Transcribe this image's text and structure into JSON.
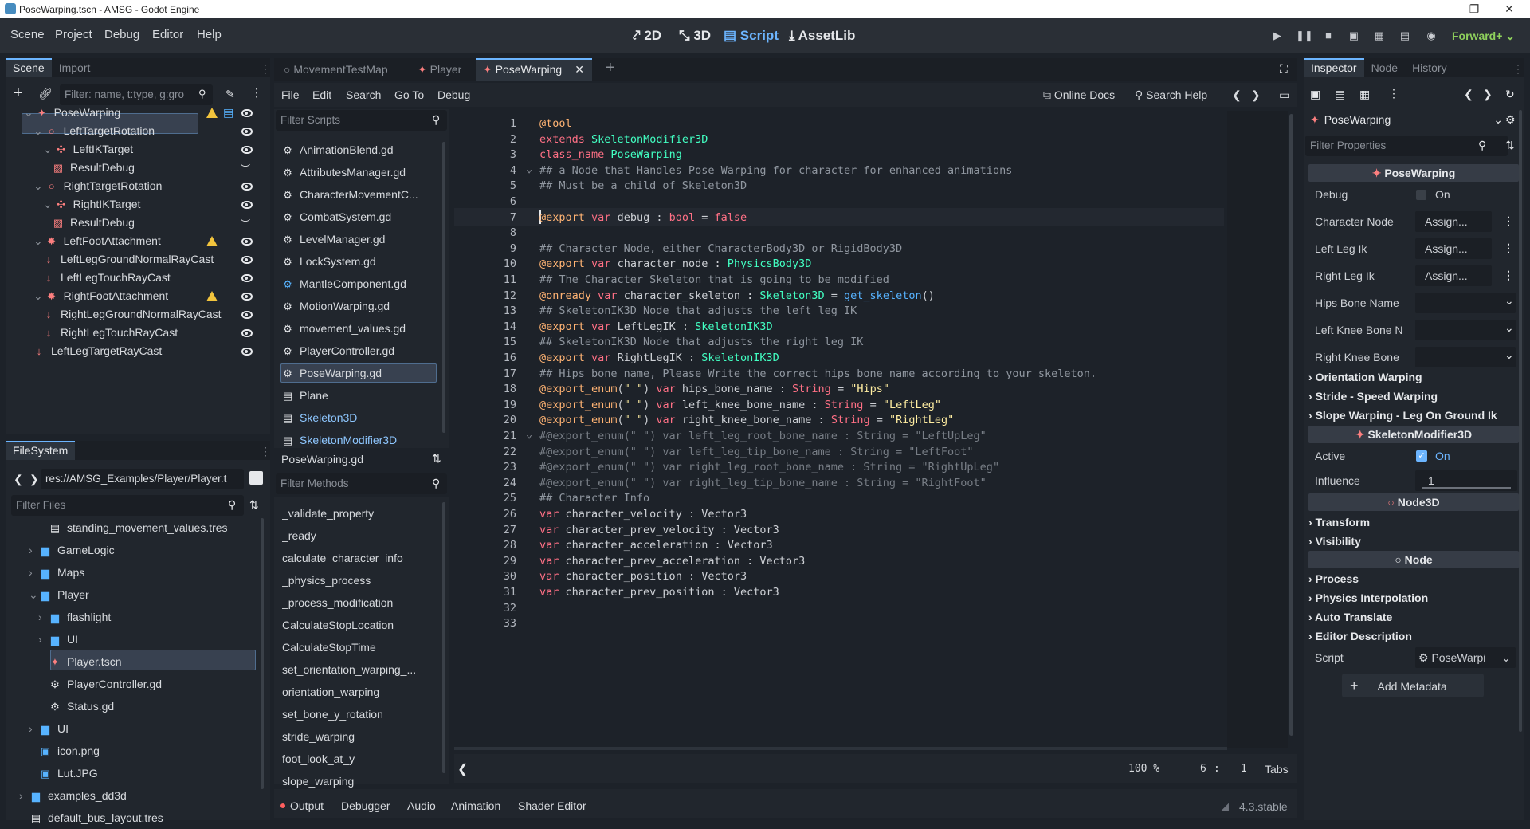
{
  "window": {
    "title": "PoseWarping.tscn - AMSG - Godot Engine"
  },
  "menus": [
    "Scene",
    "Project",
    "Debug",
    "Editor",
    "Help"
  ],
  "workspaces": [
    {
      "label": "2D",
      "icon": "2d-icon"
    },
    {
      "label": "3D",
      "icon": "3d-icon"
    },
    {
      "label": "Script",
      "icon": "script-icon"
    },
    {
      "label": "AssetLib",
      "icon": "assetlib-icon"
    }
  ],
  "renderer": "Forward+",
  "scene_dock": {
    "tabs": [
      "Scene",
      "Import"
    ],
    "filter_placeholder": "Filter: name, t:type, g:gro",
    "nodes": [
      {
        "label": "PoseWarping",
        "depth": 0,
        "icon": "pose-warping-icon",
        "warn": true,
        "script": true
      },
      {
        "label": "LeftTargetRotation",
        "depth": 1,
        "icon": "node3d-icon"
      },
      {
        "label": "LeftIKTarget",
        "depth": 2,
        "icon": "marker3d-icon"
      },
      {
        "label": "ResultDebug",
        "depth": 3,
        "icon": "debug-icon",
        "hidden_eye": true
      },
      {
        "label": "RightTargetRotation",
        "depth": 1,
        "icon": "node3d-icon"
      },
      {
        "label": "RightIKTarget",
        "depth": 2,
        "icon": "marker3d-icon"
      },
      {
        "label": "ResultDebug",
        "depth": 3,
        "icon": "debug-icon",
        "hidden_eye": true
      },
      {
        "label": "LeftFootAttachment",
        "depth": 1,
        "icon": "attachment-icon",
        "warn": true
      },
      {
        "label": "LeftLegGroundNormalRayCast",
        "depth": 2,
        "icon": "raycast-icon"
      },
      {
        "label": "LeftLegTouchRayCast",
        "depth": 2,
        "icon": "raycast-icon"
      },
      {
        "label": "RightFootAttachment",
        "depth": 1,
        "icon": "attachment-icon",
        "warn": true
      },
      {
        "label": "RightLegGroundNormalRayCast",
        "depth": 2,
        "icon": "raycast-icon"
      },
      {
        "label": "RightLegTouchRayCast",
        "depth": 2,
        "icon": "raycast-icon"
      },
      {
        "label": "LeftLegTargetRayCast",
        "depth": 1,
        "icon": "raycast-icon"
      }
    ]
  },
  "filesystem": {
    "tab": "FileSystem",
    "path": "res://AMSG_Examples/Player/Player.t",
    "filter_placeholder": "Filter Files",
    "items": [
      {
        "label": "standing_movement_values.tres",
        "depth": 3,
        "icon": "resource-icon"
      },
      {
        "label": "GameLogic",
        "depth": 2,
        "icon": "folder-icon",
        "arrow": "›"
      },
      {
        "label": "Maps",
        "depth": 2,
        "icon": "folder-icon",
        "arrow": "›"
      },
      {
        "label": "Player",
        "depth": 2,
        "icon": "folder-icon",
        "arrow": "⌄"
      },
      {
        "label": "flashlight",
        "depth": 3,
        "icon": "folder-icon",
        "arrow": "›"
      },
      {
        "label": "UI",
        "depth": 3,
        "icon": "folder-icon",
        "arrow": "›"
      },
      {
        "label": "Player.tscn",
        "depth": 3,
        "icon": "scene-icon"
      },
      {
        "label": "PlayerController.gd",
        "depth": 3,
        "icon": "gear-icon"
      },
      {
        "label": "Status.gd",
        "depth": 3,
        "icon": "gear-icon"
      },
      {
        "label": "UI",
        "depth": 2,
        "icon": "folder-icon",
        "arrow": "›"
      },
      {
        "label": "icon.png",
        "depth": 2,
        "icon": "image-icon"
      },
      {
        "label": "Lut.JPG",
        "depth": 2,
        "icon": "image-icon"
      },
      {
        "label": "examples_dd3d",
        "depth": 1,
        "icon": "folder-icon",
        "arrow": "›"
      },
      {
        "label": "default_bus_layout.tres",
        "depth": 1,
        "icon": "resource-icon"
      }
    ]
  },
  "editor_tabs": [
    "MovementTestMap",
    "Player",
    "PoseWarping"
  ],
  "script_menu": {
    "items": [
      "File",
      "Edit",
      "Search",
      "Go To",
      "Debug"
    ],
    "online_docs": "Online Docs",
    "search_help": "Search Help"
  },
  "scripts": {
    "filter_placeholder": "Filter Scripts",
    "items": [
      {
        "label": "AnimationBlend.gd",
        "icon": "gear-icon"
      },
      {
        "label": "AttributesManager.gd",
        "icon": "gear-icon"
      },
      {
        "label": "CharacterMovementC...",
        "icon": "gear-icon"
      },
      {
        "label": "CombatSystem.gd",
        "icon": "gear-icon"
      },
      {
        "label": "LevelManager.gd",
        "icon": "gear-icon"
      },
      {
        "label": "LockSystem.gd",
        "icon": "gear-icon"
      },
      {
        "label": "MantleComponent.gd",
        "icon": "gear-icon"
      },
      {
        "label": "MotionWarping.gd",
        "icon": "gear-icon"
      },
      {
        "label": "movement_values.gd",
        "icon": "gear-icon"
      },
      {
        "label": "PlayerController.gd",
        "icon": "gear-icon"
      },
      {
        "label": "PoseWarping.gd",
        "icon": "gear-icon"
      },
      {
        "label": "Plane",
        "icon": "doc-icon"
      },
      {
        "label": "Skeleton3D",
        "icon": "doc-icon"
      },
      {
        "label": "SkeletonModifier3D",
        "icon": "doc-icon"
      }
    ],
    "current": "PoseWarping.gd"
  },
  "methods": {
    "filter_placeholder": "Filter Methods",
    "items": [
      "_validate_property",
      "_ready",
      "calculate_character_info",
      "_physics_process",
      "_process_modification",
      "CalculateStopLocation",
      "CalculateStopTime",
      "set_orientation_warping_...",
      "orientation_warping",
      "set_bone_y_rotation",
      "stride_warping",
      "foot_look_at_y",
      "slope_warping"
    ]
  },
  "code": {
    "lines": [
      {
        "n": "1",
        "t": "@tool"
      },
      {
        "n": "2",
        "t": "extends SkeletonModifier3D"
      },
      {
        "n": "3",
        "t": "class_name PoseWarping"
      },
      {
        "n": "4",
        "t": "## a Node that Handles Pose Warping for character for enhanced animations"
      },
      {
        "n": "5",
        "t": "## Must be a child of Skeleton3D"
      },
      {
        "n": "6",
        "t": ""
      },
      {
        "n": "7",
        "t": "@export var debug : bool = false"
      },
      {
        "n": "8",
        "t": ""
      },
      {
        "n": "9",
        "t": "## Character Node, either CharacterBody3D or RigidBody3D"
      },
      {
        "n": "10",
        "t": "@export var character_node : PhysicsBody3D"
      },
      {
        "n": "11",
        "t": "## The Character Skeleton that is going to be modified"
      },
      {
        "n": "12",
        "t": "@onready var character_skeleton : Skeleton3D = get_skeleton()"
      },
      {
        "n": "13",
        "t": "## SkeletonIK3D Node that adjusts the left leg IK"
      },
      {
        "n": "14",
        "t": "@export var LeftLegIK : SkeletonIK3D"
      },
      {
        "n": "15",
        "t": "## SkeletonIK3D Node that adjusts the right leg IK"
      },
      {
        "n": "16",
        "t": "@export var RightLegIK : SkeletonIK3D"
      },
      {
        "n": "17",
        "t": "## Hips bone name, Please Write the correct hips bone name according to your skeleton."
      },
      {
        "n": "18",
        "t": "@export_enum(\" \") var hips_bone_name : String = \"Hips\""
      },
      {
        "n": "19",
        "t": "@export_enum(\" \") var left_knee_bone_name : String = \"LeftLeg\""
      },
      {
        "n": "20",
        "t": "@export_enum(\" \") var right_knee_bone_name : String = \"RightLeg\""
      },
      {
        "n": "21",
        "t": "#@export_enum(\" \") var left_leg_root_bone_name : String = \"LeftUpLeg\""
      },
      {
        "n": "22",
        "t": "#@export_enum(\" \") var left_leg_tip_bone_name : String = \"LeftFoot\""
      },
      {
        "n": "23",
        "t": "#@export_enum(\" \") var right_leg_root_bone_name : String = \"RightUpLeg\""
      },
      {
        "n": "24",
        "t": "#@export_enum(\" \") var right_leg_tip_bone_name : String = \"RightFoot\""
      },
      {
        "n": "25",
        "t": "## Character Info"
      },
      {
        "n": "26",
        "t": "var character_velocity : Vector3"
      },
      {
        "n": "27",
        "t": "var character_prev_velocity : Vector3"
      },
      {
        "n": "28",
        "t": "var character_acceleration : Vector3"
      },
      {
        "n": "29",
        "t": "var character_prev_acceleration : Vector3"
      },
      {
        "n": "30",
        "t": "var character_position : Vector3"
      },
      {
        "n": "31",
        "t": "var character_prev_position : Vector3"
      },
      {
        "n": "32",
        "t": ""
      },
      {
        "n": "33",
        "t": ""
      }
    ],
    "zoom": "100 %",
    "cursor_line": "6",
    "cursor_col": "1",
    "indent": "Tabs"
  },
  "bottom_panel": {
    "tabs": [
      "Output",
      "Debugger",
      "Audio",
      "Animation",
      "Shader Editor"
    ],
    "version": "4.3.stable"
  },
  "inspector": {
    "tabs": [
      "Inspector",
      "Node",
      "History"
    ],
    "object": "PoseWarping",
    "filter_placeholder": "Filter Properties",
    "category1": "PoseWarping",
    "props": [
      {
        "label": "Debug",
        "value": "On",
        "type": "check",
        "checked": false
      },
      {
        "label": "Character Node",
        "value": "Assign...",
        "type": "assign"
      },
      {
        "label": "Left Leg Ik",
        "value": "Assign...",
        "type": "assign"
      },
      {
        "label": "Right Leg Ik",
        "value": "Assign...",
        "type": "assign"
      },
      {
        "label": "Hips Bone Name",
        "value": "",
        "type": "enum"
      },
      {
        "label": "Left Knee Bone N",
        "value": "",
        "type": "enum"
      },
      {
        "label": "Right Knee Bone",
        "value": "",
        "type": "enum"
      }
    ],
    "groups1": [
      "Orientation Warping",
      "Stride - Speed Warping",
      "Slope Warping - Leg On Ground Ik"
    ],
    "category2": "SkeletonModifier3D",
    "active": {
      "label": "Active",
      "value": "On"
    },
    "influence": {
      "label": "Influence",
      "value": "1"
    },
    "category3": "Node3D",
    "groups2": [
      "Transform",
      "Visibility"
    ],
    "category4": "Node",
    "groups3": [
      "Process",
      "Physics Interpolation",
      "Auto Translate",
      "Editor Description"
    ],
    "script": {
      "label": "Script",
      "value": "PoseWarpi"
    },
    "add_metadata": "Add Metadata"
  },
  "colors": {
    "accent": "#6cb5ff",
    "warning": "#f2c43d",
    "renderer": "#8ed05c"
  }
}
